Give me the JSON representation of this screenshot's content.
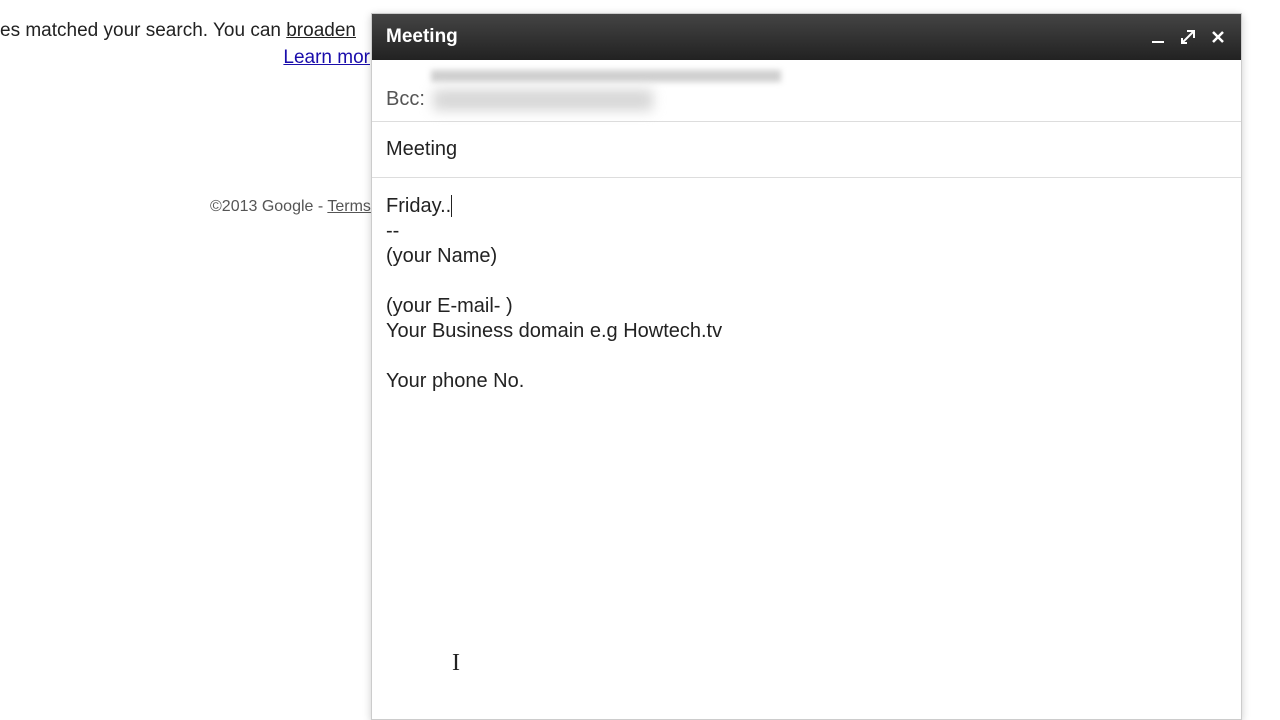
{
  "background": {
    "line1_prefix": "es matched your search. You can ",
    "broaden_link": "broaden",
    "learn_more": "Learn mor"
  },
  "footer": {
    "copyright": "©2013 Google - ",
    "terms": "Terms"
  },
  "compose": {
    "title": "Meeting",
    "bcc_label": "Bcc:",
    "subject": "Meeting",
    "body_line1": "Friday..",
    "body_sig_sep": "--",
    "body_name": "(your Name)",
    "body_email": "(your E-mail- )",
    "body_domain": "Your Business domain e.g Howtech.tv",
    "body_phone": "Your phone No."
  }
}
